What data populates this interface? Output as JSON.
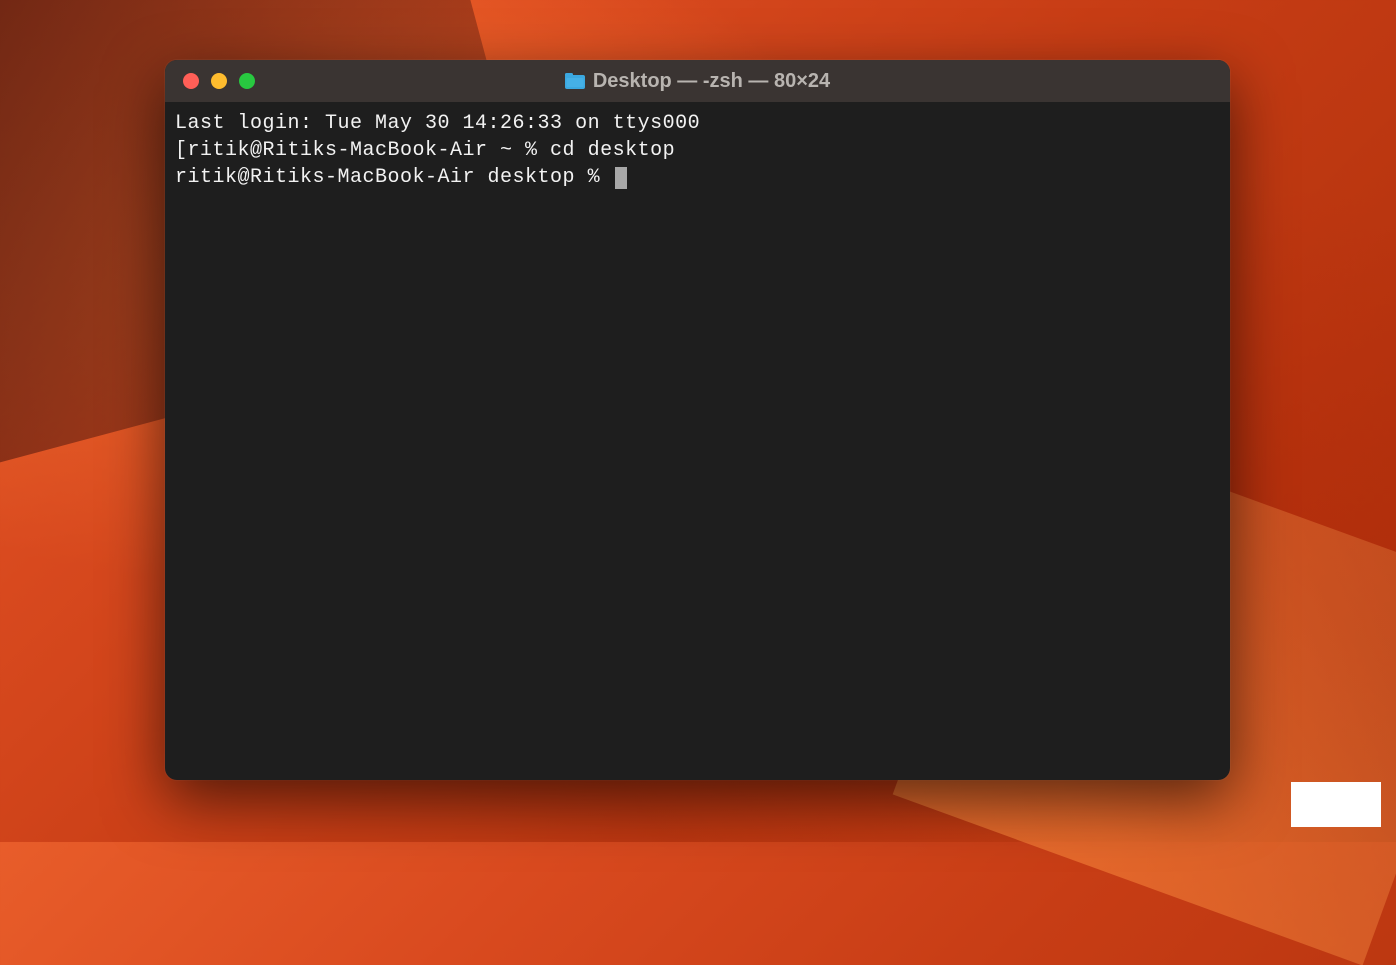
{
  "window": {
    "title": "Desktop — -zsh — 80×24"
  },
  "terminal": {
    "lines": [
      "Last login: Tue May 30 14:26:33 on ttys000",
      "[ritik@Ritiks-MacBook-Air ~ % cd desktop",
      "ritik@Ritiks-MacBook-Air desktop % "
    ]
  },
  "colors": {
    "titlebar": "#3a3432",
    "terminal_bg": "#1e1e1e",
    "terminal_fg": "#f2f2f2",
    "close": "#ff5f57",
    "minimize": "#febc2e",
    "maximize": "#28c840"
  }
}
